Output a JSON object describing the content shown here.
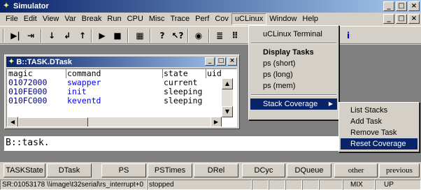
{
  "window": {
    "title": "Simulator"
  },
  "menubar": [
    "File",
    "Edit",
    "View",
    "Var",
    "Break",
    "Run",
    "CPU",
    "Misc",
    "Trace",
    "Perf",
    "Cov",
    "uCLinux",
    "Window",
    "Help"
  ],
  "toolbar": {
    "icons": [
      "step-icon",
      "step-over-icon",
      "down-icon",
      "return-icon",
      "up-icon",
      "go-icon",
      "stop-icon",
      "register-icon",
      "help-icon",
      "context-help-icon",
      "debug-icon",
      "list-icon",
      "dump-icon",
      "info-icon"
    ]
  },
  "task_window": {
    "title": "B::TASK.DTask",
    "columns": [
      "magic",
      "command",
      "state",
      "uid"
    ],
    "rows": [
      {
        "magic": "01072000",
        "command": "swapper",
        "state": "current"
      },
      {
        "magic": "010FE000",
        "command": "init",
        "state": "sleeping"
      },
      {
        "magic": "010FC000",
        "command": "keventd",
        "state": "sleeping"
      }
    ]
  },
  "uclinux_menu": {
    "items": [
      {
        "label": "uCLinux Terminal"
      },
      {
        "label": "Display Tasks",
        "bold": true
      },
      {
        "label": "ps (short)"
      },
      {
        "label": "ps (long)"
      },
      {
        "label": "ps (mem)"
      },
      {
        "label": "Stack Coverage"
      }
    ]
  },
  "stack_submenu": {
    "items": [
      "List Stacks",
      "Add Task",
      "Remove Task",
      "Reset Coverage"
    ]
  },
  "command_line": {
    "text": "B::task."
  },
  "function_buttons": [
    "TASKState",
    "DTask",
    "PS",
    "PSTimes",
    "DRel",
    "DCyc",
    "DQueue",
    "other",
    "previous"
  ],
  "status_bar": {
    "address": "SR:01053178 \\\\image\\t32serial\\rs_interrupt+0",
    "state": "stopped",
    "mode": "MIX",
    "direction": "UP"
  }
}
